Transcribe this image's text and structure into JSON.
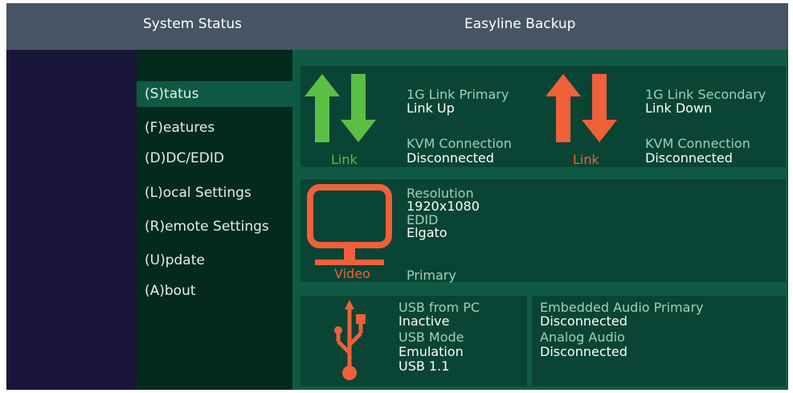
{
  "header": {
    "left_title": "System Status",
    "right_title": "Easyline Backup"
  },
  "menu": {
    "items": [
      {
        "label": "(S)tatus",
        "selected": true
      },
      {
        "label": "(F)eatures",
        "selected": false
      },
      {
        "label": "(D)DC/EDID",
        "selected": false
      },
      {
        "label": "(L)ocal  Settings",
        "selected": false
      },
      {
        "label": "(R)emote Settings",
        "selected": false
      },
      {
        "label": "(U)pdate",
        "selected": false
      },
      {
        "label": "(A)bout",
        "selected": false
      }
    ]
  },
  "links": {
    "primary": {
      "icon_label": "Link",
      "icon_color": "#5cbf45",
      "link_title": "1G Link Primary",
      "link_value": "Link Up",
      "kvm_title": "KVM Connection",
      "kvm_value": "Disconnected"
    },
    "secondary": {
      "icon_label": "Link",
      "icon_color": "#f0603a",
      "link_title": "1G Link Secondary",
      "link_value": "Link Down",
      "kvm_title": "KVM Connection",
      "kvm_value": "Disconnected"
    }
  },
  "video": {
    "icon_label": "Video",
    "icon_color": "#f0603a",
    "resolution_title": "Resolution",
    "resolution_value": "1920x1080",
    "edid_title": "EDID",
    "edid_value": "Elgato",
    "source": "Primary"
  },
  "usb": {
    "icon_color": "#f0603a",
    "from_pc_title": "USB from PC",
    "from_pc_value": "Inactive",
    "mode_title": "USB Mode",
    "mode_value": "Emulation",
    "mode_version": "USB 1.1"
  },
  "audio": {
    "embedded_title": "Embedded Audio Primary",
    "embedded_value": "Disconnected",
    "analog_title": "Analog Audio",
    "analog_value": "Disconnected"
  },
  "colors": {
    "header_bg": "#475463",
    "menu_bg": "#042a1d",
    "menu_selected_bg": "#0e5a44",
    "main_bg": "#0f5a44",
    "panel_bg": "#0a4434",
    "outer_bg": "#1a153a"
  }
}
